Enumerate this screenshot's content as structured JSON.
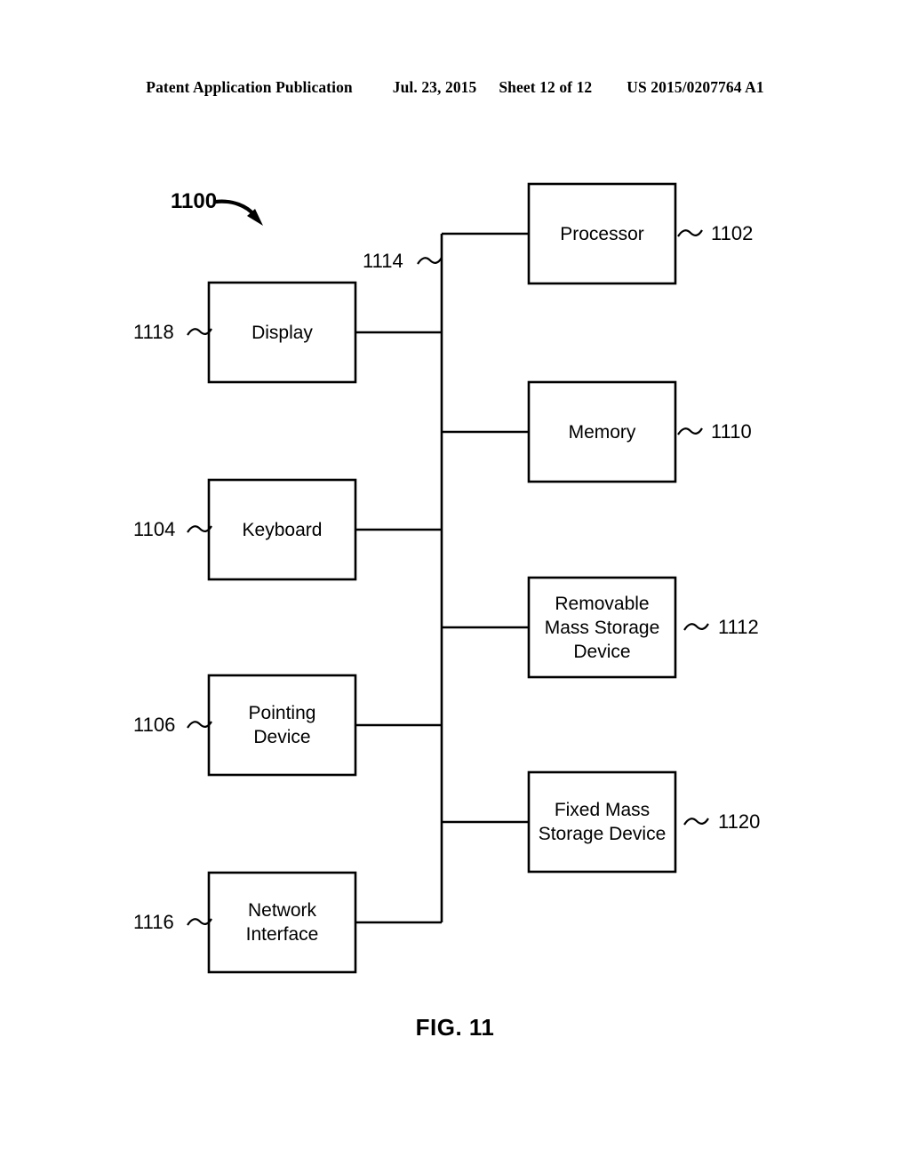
{
  "header": {
    "publication": "Patent Application Publication",
    "date": "Jul. 23, 2015",
    "sheet": "Sheet 12 of 12",
    "patent_number": "US 2015/0207764 A1"
  },
  "figure": {
    "caption": "FIG. 11",
    "system_numeral": "1100",
    "bus_numeral": "1114",
    "line_color": "#000000",
    "background_color": "#ffffff"
  },
  "blocks": {
    "display": {
      "label": "Display",
      "ref": "1118"
    },
    "keyboard": {
      "label": "Keyboard",
      "ref": "1104"
    },
    "pointing_device": {
      "label": "Pointing\nDevice",
      "ref": "1106"
    },
    "network_interface": {
      "label": "Network\nInterface",
      "ref": "1116"
    },
    "processor": {
      "label": "Processor",
      "ref": "1102"
    },
    "memory": {
      "label": "Memory",
      "ref": "1110"
    },
    "removable_storage": {
      "label": "Removable\nMass Storage\nDevice",
      "ref": "1112"
    },
    "fixed_storage": {
      "label": "Fixed Mass\nStorage Device",
      "ref": "1120"
    }
  }
}
